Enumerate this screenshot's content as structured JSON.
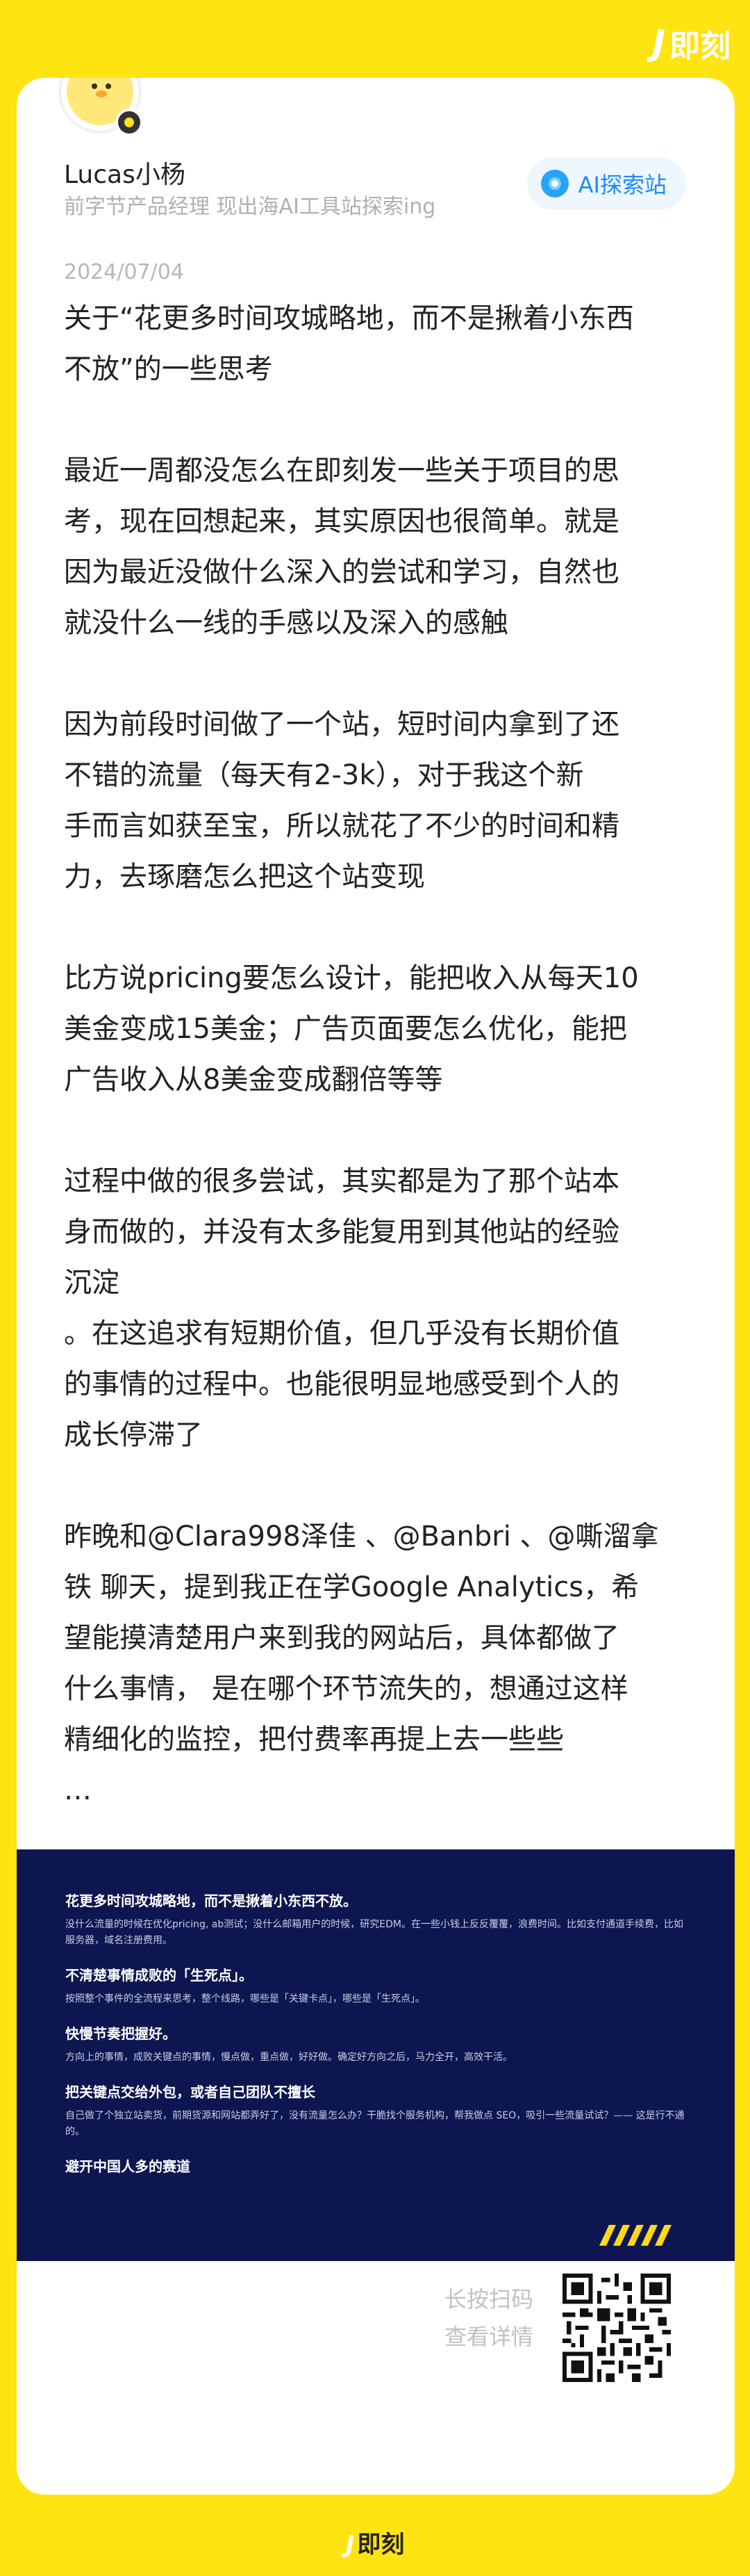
{
  "brand": {
    "logo_text": "即刻"
  },
  "author": {
    "name": "Lucas小杨",
    "bio": "前字节产品经理 现出海AI工具站探索ing"
  },
  "topic": {
    "label": "AI探索站"
  },
  "post": {
    "date": "2024/07/04",
    "body": "关于“花更多时间攻城略地，而不是揪着小东西\n不放”的一些思考\n\n最近一周都没怎么在即刻发一些关于项目的思\n考，现在回想起来，其实原因也很简单。就是\n因为最近没做什么深入的尝试和学习，自然也\n就没什么一线的手感以及深入的感触\n\n因为前段时间做了一个站，短时间内拿到了还\n不错的流量（每天有2-3k），对于我这个新\n手而言如获至宝，所以就花了不少的时间和精\n力，去琢磨怎么把这个站变现\n\n比方说pricing要怎么设计，能把收入从每天10\n美金变成15美金；广告页面要怎么优化，能把\n广告收入从8美金变成翻倍等等\n\n过程中做的很多尝试，其实都是为了那个站本\n身而做的，并没有太多能复用到其他站的经验\n沉淀\n。在这追求有短期价值，但几乎没有长期价值\n的事情的过程中。也能很明显地感受到个人的\n成长停滞了\n\n昨晚和@Clara998泽佳 、@Banbri 、@嘶溜拿\n铁 聊天，提到我正在学Google Analytics，希\n望能摸清楚用户来到我的网站后，具体都做了\n什么事情， 是在哪个环节流失的，想通过这样\n精细化的监控，把付费率再提上去一些些\n…"
  },
  "banner": {
    "sections": [
      {
        "heading": "花更多时间攻城略地，而不是揪着小东西不放。",
        "text": "没什么流量的时候在优化pricing, ab测试；没什么邮箱用户的时候，研究EDM。在一些小钱上反反覆覆，浪费时间。比如支付通道手续费，比如服务器，域名注册费用。"
      },
      {
        "heading": "不清楚事情成败的「生死点」。",
        "text": "按照整个事件的全流程来思考，整个线路，哪些是「关键卡点」，哪些是「生死点」。"
      },
      {
        "heading": "快慢节奏把握好。",
        "text": "方向上的事情，成败关键点的事情，慢点做，重点做，好好做。确定好方向之后，马力全开，高效干活。"
      },
      {
        "heading": "把关键点交给外包，或者自己团队不擅长",
        "text": "自己做了个独立站卖货，前期货源和网站都弄好了，没有流量怎么办？干脆找个服务机构，帮我做点 SEO，吸引一些流量试试？—— 这是行不通的。"
      },
      {
        "heading": "避开中国人多的赛道",
        "text": ""
      }
    ]
  },
  "footer": {
    "scan_line1": "长按扫码",
    "scan_line2": "查看详情"
  }
}
